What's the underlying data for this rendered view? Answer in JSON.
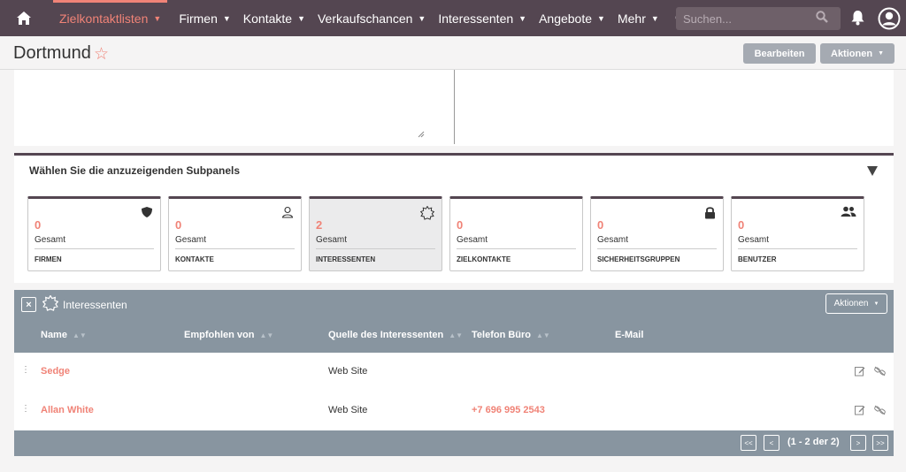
{
  "nav": {
    "items": [
      {
        "label": "Zielkontaktlisten",
        "active": true
      },
      {
        "label": "Firmen"
      },
      {
        "label": "Kontakte"
      },
      {
        "label": "Verkaufschancen"
      },
      {
        "label": "Interessenten"
      },
      {
        "label": "Angebote"
      },
      {
        "label": "Mehr"
      }
    ],
    "search_placeholder": "Suchen..."
  },
  "header": {
    "title": "Dortmund",
    "edit_label": "Bearbeiten",
    "actions_label": "Aktionen"
  },
  "chooser": {
    "title": "Wählen Sie die anzuzeigenden Subpanels",
    "cards": [
      {
        "count": "0",
        "total": "Gesamt",
        "label": "FIRMEN",
        "icon": "shield-icon"
      },
      {
        "count": "0",
        "total": "Gesamt",
        "label": "KONTAKTE",
        "icon": "person-icon"
      },
      {
        "count": "2",
        "total": "Gesamt",
        "label": "INTERESSENTEN",
        "icon": "starburst-icon",
        "active": true
      },
      {
        "count": "0",
        "total": "Gesamt",
        "label": "ZIELKONTAKTE",
        "icon": ""
      },
      {
        "count": "0",
        "total": "Gesamt",
        "label": "SICHERHEITSGRUPPEN",
        "icon": "lock-icon"
      },
      {
        "count": "0",
        "total": "Gesamt",
        "label": "BENUTZER",
        "icon": "users-icon"
      }
    ]
  },
  "subpanel": {
    "title": "Interessenten",
    "actions_label": "Aktionen",
    "columns": [
      "Name",
      "Empfohlen von",
      "Quelle des Interessenten",
      "Telefon Büro",
      "E-Mail"
    ],
    "rows": [
      {
        "name": "Sedge",
        "referred": "",
        "source": "Web Site",
        "phone": "",
        "email": ""
      },
      {
        "name": "Allan White",
        "referred": "",
        "source": "Web Site",
        "phone": "+7 696 995 2543",
        "email": ""
      }
    ],
    "pagination": {
      "first": "<<",
      "prev": "<",
      "info": "(1 - 2 der 2)",
      "next": ">",
      "last": ">>"
    }
  },
  "colors": {
    "nav_bg": "#544651",
    "accent": "#f08377",
    "panel_header": "#8895a0"
  }
}
